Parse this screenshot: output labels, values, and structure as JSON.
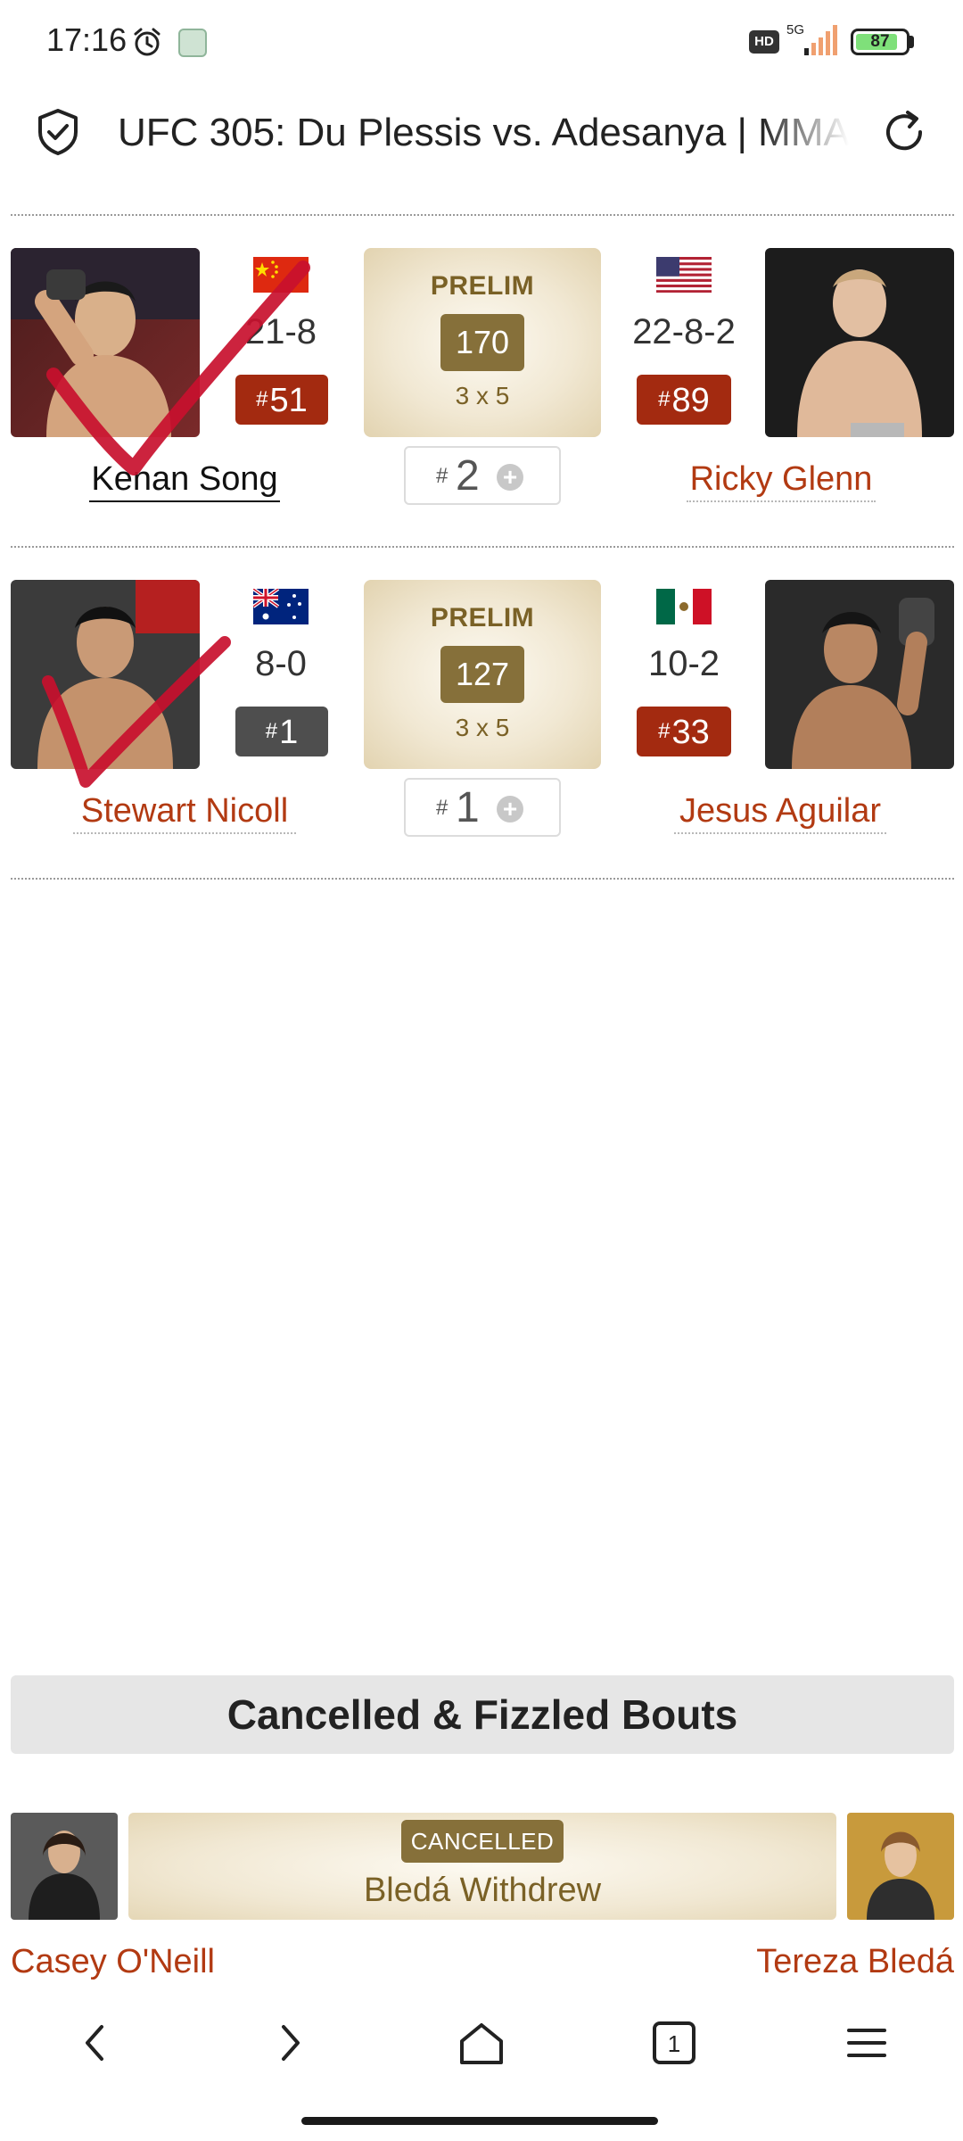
{
  "status_bar": {
    "time": "17:16",
    "battery": "87",
    "battery_level": 0.87,
    "network": "5G",
    "hd_label": "HD",
    "icons": [
      "alarm-clock-icon",
      "app-notification-icon",
      "hd-icon",
      "signal-icon",
      "battery-icon"
    ]
  },
  "browser": {
    "title": "UFC 305: Du Plessis vs. Adesanya | MMA",
    "icons": [
      "shield-check-icon",
      "reload-icon"
    ]
  },
  "bouts": [
    {
      "left": {
        "name": "Kenan Song",
        "record": "21-8",
        "rank": "51",
        "flag": "china-flag-icon",
        "picked": true
      },
      "center": {
        "label": "PRELIM",
        "weight": "170",
        "rounds": "3 x 5",
        "pick_hash": "#",
        "pick_number": "2"
      },
      "right": {
        "name": "Ricky Glenn",
        "record": "22-8-2",
        "rank": "89",
        "flag": "usa-flag-icon"
      },
      "rank_hash": "#"
    },
    {
      "left": {
        "name": "Stewart Nicoll",
        "record": "8-0",
        "rank": "1",
        "flag": "australia-flag-icon",
        "picked": true
      },
      "center": {
        "label": "PRELIM",
        "weight": "127",
        "rounds": "3 x 5",
        "pick_hash": "#",
        "pick_number": "1"
      },
      "right": {
        "name": "Jesus Aguilar",
        "record": "10-2",
        "rank": "33",
        "flag": "mexico-flag-icon"
      },
      "rank_hash": "#"
    }
  ],
  "cancelled": {
    "heading": "Cancelled & Fizzled Bouts",
    "bouts": [
      {
        "left": "Casey O'Neill",
        "right": "Tereza Bledá",
        "status": "CANCELLED",
        "note": "Bledá Withdrew"
      }
    ]
  },
  "nav": {
    "items": [
      "back-icon",
      "forward-icon",
      "home-icon",
      "tabs-icon",
      "menu-icon"
    ],
    "tab_count": "1"
  },
  "colors": {
    "accent_red": "#a32a10",
    "gold": "#86703a",
    "name_red": "#b23a12",
    "check_red": "#c8102e"
  }
}
